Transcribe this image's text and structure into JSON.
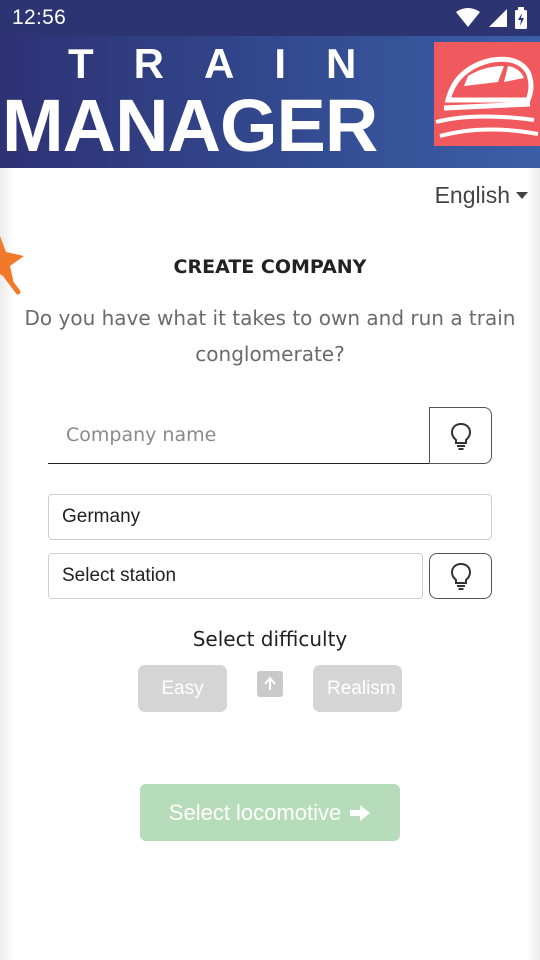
{
  "status_bar": {
    "time": "12:56",
    "icons": [
      "wifi-icon",
      "signal-icon",
      "battery-icon"
    ]
  },
  "header": {
    "logo_line1": "TRAIN",
    "logo_line2": "MANAGER",
    "logo_icon": "train-icon",
    "logo_color": "#f05a5e",
    "banner_color": "#2d3274"
  },
  "language": {
    "selected": "English"
  },
  "form": {
    "title": "CREATE COMPANY",
    "subtitle": "Do you have what it takes to own and run a train conglomerate?",
    "company_name": {
      "value": "",
      "placeholder": "Company name"
    },
    "country": "Germany",
    "station": "Select station",
    "difficulty_label": "Select difficulty",
    "difficulty_options": [
      "Easy",
      "Realism"
    ],
    "submit_label": "Select locomotive",
    "submit_color": "#b7dcb9"
  }
}
